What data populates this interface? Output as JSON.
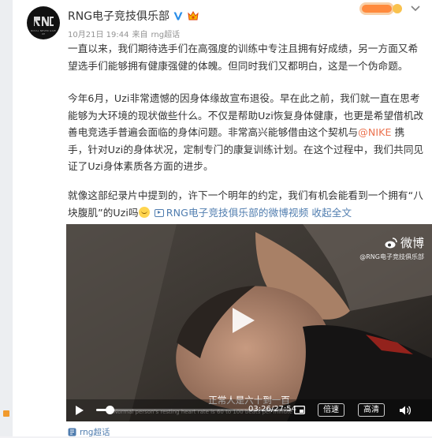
{
  "post": {
    "author": "RNG电子竞技俱乐部",
    "time": "10月21日 19:44",
    "source_prefix": "来自",
    "source": "rng超话",
    "logo_caption": "ROYAL NEVER GIVE UP",
    "p1": "一直以来，我们期待选手们在高强度的训练中专注且拥有好成绩，另一方面又希望选手们能够拥有健康强健的体魄。但同时我们又都明白，这是一个伪命题。",
    "p2_a": "今年6月，Uzi非常遗憾的因身体缘故宣布退役。早在此之前，我们就一直在思考能够为大环境的现状做些什么。不仅是帮助Uzi恢复身体健康，也更是希望借机改善电竞选手普遍会面临的身体问题。非常高兴能够借由这个契机与",
    "mention": "@NIKE",
    "p2_b": " 携手，针对Uzi的身体状况，定制专门的康复训练计划。在这个过程中，我们共同见证了Uzi身体素质各方面的进步。",
    "p3_a": "就像这部纪录片中提到的，许下一个明年的约定，我们有机会能看到一个拥有“八块腹肌”的Uzi吗",
    "video_link": "RNG电子竞技俱乐部的微博视频",
    "expand": "收起全文",
    "tag": "rng超话"
  },
  "video": {
    "watermark": "微博",
    "watermark_sub": "@RNG电子竞技俱乐部",
    "subtitle": "正常人是六十到一百",
    "time": "03:26/27:54",
    "speed_label": "倍速",
    "quality_label": "高清",
    "progress": 0.07,
    "faint_text": "Normal person's resting heart rate is 60 to 100 beats per minute"
  },
  "colors": {
    "link": "#507daf",
    "mention": "#eb7350",
    "meta": "#939393"
  },
  "icons": [
    "verified-icon",
    "vip-badge-icon",
    "chevron-down-icon",
    "play-icon",
    "pip-icon",
    "volume-icon",
    "weibo-logo-icon",
    "video-link-icon",
    "super-topic-icon"
  ]
}
